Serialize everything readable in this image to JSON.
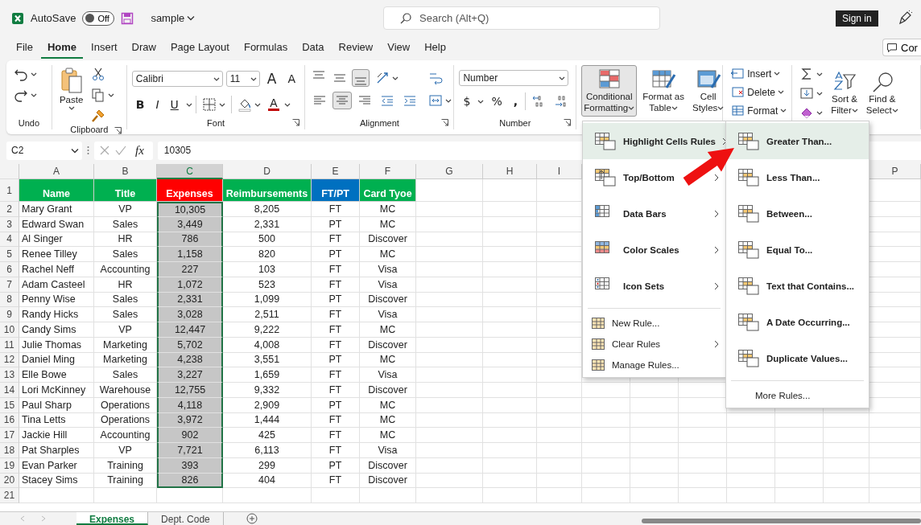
{
  "title_bar": {
    "autosave_label": "AutoSave",
    "autosave": {
      "on": false,
      "label": "Off"
    },
    "file_name": "sample",
    "search": {
      "placeholder": "Search (Alt+Q)"
    },
    "sign_in": "Sign in"
  },
  "menu_tabs": [
    {
      "label": "File",
      "selected": false
    },
    {
      "label": "Home",
      "selected": true
    },
    {
      "label": "Insert",
      "selected": false
    },
    {
      "label": "Draw",
      "selected": false
    },
    {
      "label": "Page Layout",
      "selected": false
    },
    {
      "label": "Formulas",
      "selected": false
    },
    {
      "label": "Data",
      "selected": false
    },
    {
      "label": "Review",
      "selected": false
    },
    {
      "label": "View",
      "selected": false
    },
    {
      "label": "Help",
      "selected": false
    }
  ],
  "comments_button": "Cor",
  "ribbon": {
    "groups": [
      {
        "kind": "undo",
        "label": "Undo"
      },
      {
        "kind": "clipboard",
        "label": "Clipboard",
        "paste": "Paste"
      },
      {
        "kind": "font",
        "label": "Font",
        "font_name": "Calibri",
        "font_size": "11",
        "grow": "A",
        "shrink": "A",
        "bold": "B",
        "italic": "I",
        "underline": "U",
        "font_color": "A"
      },
      {
        "kind": "alignment",
        "label": "Alignment",
        "vertical": [
          {
            "selected": false
          },
          {
            "selected": false
          },
          {
            "selected": true
          }
        ],
        "horizontal": [
          {
            "selected": false
          },
          {
            "selected": true
          },
          {
            "selected": false
          }
        ]
      },
      {
        "kind": "number",
        "label": "Number",
        "format": "Number",
        "currency": "$",
        "percent": "%",
        "comma": ","
      },
      {
        "kind": "styles",
        "buttons": [
          {
            "lines": [
              "Conditional",
              "Formatting"
            ],
            "selected": true
          },
          {
            "lines": [
              "Format as",
              "Table"
            ],
            "selected": false
          },
          {
            "lines": [
              "Cell",
              "Styles"
            ],
            "selected": false
          }
        ]
      },
      {
        "kind": "cells",
        "buttons": [
          "Insert",
          "Delete",
          "Format"
        ]
      },
      {
        "kind": "editing",
        "buttons": [
          {
            "lines": [
              "Sort &",
              "Filter"
            ]
          },
          {
            "lines": [
              "Find &",
              "Select"
            ]
          }
        ]
      }
    ]
  },
  "formula_bar": {
    "name_box": "C2",
    "fx": "fx",
    "formula": "10305"
  },
  "sheet": {
    "columns": [
      {
        "letter": "A",
        "selected": false
      },
      {
        "letter": "B",
        "selected": false
      },
      {
        "letter": "C",
        "selected": true
      },
      {
        "letter": "D",
        "selected": false
      },
      {
        "letter": "E",
        "selected": false
      },
      {
        "letter": "F",
        "selected": false
      },
      {
        "letter": "G",
        "selected": false
      },
      {
        "letter": "H",
        "selected": false
      },
      {
        "letter": "I",
        "selected": false
      },
      {
        "letter": "P",
        "selected": false
      }
    ],
    "header": {
      "number": "1",
      "cells": [
        {
          "text": "Name",
          "color": "#00b050"
        },
        {
          "text": "Title",
          "color": "#00b050"
        },
        {
          "text": "Expenses",
          "color": "#ff0000"
        },
        {
          "text": "Reimbursements",
          "color": "#00b050"
        },
        {
          "text": "FT/PT",
          "color": "#0070c0"
        },
        {
          "text": "Card Tyoe",
          "color": "#00b050"
        }
      ]
    },
    "rows": [
      {
        "number": "2",
        "cells": [
          "Mary Grant",
          "VP",
          "10,305",
          "8,205",
          "FT",
          "MC"
        ]
      },
      {
        "number": "3",
        "cells": [
          "Edward Swan",
          "Sales",
          "3,449",
          "2,331",
          "PT",
          "MC"
        ]
      },
      {
        "number": "4",
        "cells": [
          "Al Singer",
          "HR",
          "786",
          "500",
          "FT",
          "Discover"
        ]
      },
      {
        "number": "5",
        "cells": [
          "Renee Tilley",
          "Sales",
          "1,158",
          "820",
          "PT",
          "MC"
        ]
      },
      {
        "number": "6",
        "cells": [
          "Rachel Neff",
          "Accounting",
          "227",
          "103",
          "FT",
          "Visa"
        ]
      },
      {
        "number": "7",
        "cells": [
          "Adam Casteel",
          "HR",
          "1,072",
          "523",
          "FT",
          "Visa"
        ]
      },
      {
        "number": "8",
        "cells": [
          "Penny Wise",
          "Sales",
          "2,331",
          "1,099",
          "PT",
          "Discover"
        ]
      },
      {
        "number": "9",
        "cells": [
          "Randy Hicks",
          "Sales",
          "3,028",
          "2,511",
          "FT",
          "Visa"
        ]
      },
      {
        "number": "10",
        "cells": [
          "Candy Sims",
          "VP",
          "12,447",
          "9,222",
          "FT",
          "MC"
        ]
      },
      {
        "number": "11",
        "cells": [
          "Julie Thomas",
          "Marketing",
          "5,702",
          "4,008",
          "FT",
          "Discover"
        ]
      },
      {
        "number": "12",
        "cells": [
          "Daniel Ming",
          "Marketing",
          "4,238",
          "3,551",
          "PT",
          "MC"
        ]
      },
      {
        "number": "13",
        "cells": [
          "Elle Bowe",
          "Sales",
          "3,227",
          "1,659",
          "FT",
          "Visa"
        ]
      },
      {
        "number": "14",
        "cells": [
          "Lori McKinney",
          "Warehouse",
          "12,755",
          "9,332",
          "FT",
          "Discover"
        ]
      },
      {
        "number": "15",
        "cells": [
          "Paul Sharp",
          "Operations",
          "4,118",
          "2,909",
          "PT",
          "MC"
        ]
      },
      {
        "number": "16",
        "cells": [
          "Tina Letts",
          "Operations",
          "3,972",
          "1,444",
          "FT",
          "MC"
        ]
      },
      {
        "number": "17",
        "cells": [
          "Jackie Hill",
          "Accounting",
          "902",
          "425",
          "FT",
          "MC"
        ]
      },
      {
        "number": "18",
        "cells": [
          "Pat Sharples",
          "VP",
          "7,721",
          "6,113",
          "FT",
          "Visa"
        ]
      },
      {
        "number": "19",
        "cells": [
          "Evan Parker",
          "Training",
          "393",
          "299",
          "PT",
          "Discover"
        ]
      },
      {
        "number": "20",
        "cells": [
          "Stacey Sims",
          "Training",
          "826",
          "404",
          "FT",
          "Discover"
        ]
      },
      {
        "number": "21",
        "cells": []
      }
    ]
  },
  "sheet_tabs": [
    {
      "label": "Expenses",
      "selected": true
    },
    {
      "label": "Dept. Code",
      "selected": false
    }
  ],
  "cf_menu": {
    "items": [
      {
        "kind": "large",
        "label": "Highlight Cells Rules",
        "submenu": true,
        "selected": true
      },
      {
        "kind": "large",
        "label": "Top/Bottom",
        "submenu": true,
        "selected": false
      },
      {
        "kind": "large",
        "label": "Data Bars",
        "submenu": true,
        "selected": false
      },
      {
        "kind": "large",
        "label": "Color Scales",
        "submenu": true,
        "selected": false
      },
      {
        "kind": "large",
        "label": "Icon Sets",
        "submenu": true,
        "selected": false
      },
      {
        "kind": "small",
        "label": "New Rule...",
        "submenu": false,
        "selected": false
      },
      {
        "kind": "small",
        "label": "Clear Rules",
        "submenu": true,
        "selected": false
      },
      {
        "kind": "small",
        "label": "Manage Rules...",
        "submenu": false,
        "selected": false
      }
    ]
  },
  "submenu": {
    "items": [
      {
        "kind": "large",
        "label": "Greater Than...",
        "selected": true
      },
      {
        "kind": "large",
        "label": "Less Than...",
        "selected": false
      },
      {
        "kind": "large",
        "label": "Between...",
        "selected": false
      },
      {
        "kind": "large",
        "label": "Equal To...",
        "selected": false
      },
      {
        "kind": "large",
        "label": "Text that Contains...",
        "selected": false
      },
      {
        "kind": "large",
        "label": "A Date Occurring...",
        "selected": false
      },
      {
        "kind": "large",
        "label": "Duplicate Values...",
        "selected": false
      },
      {
        "kind": "plain",
        "label": "More Rules...",
        "selected": false
      }
    ]
  }
}
